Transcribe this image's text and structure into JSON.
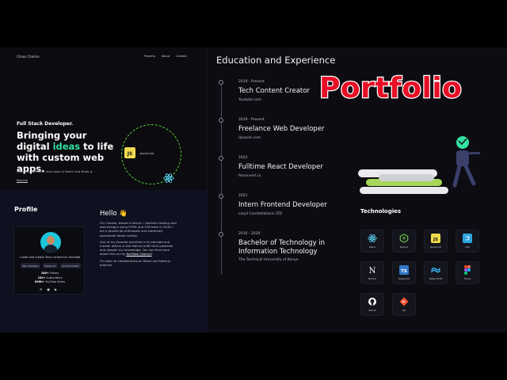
{
  "nav": {
    "brand": "Chaos Charles",
    "links": [
      "Projects",
      "About",
      "Contact"
    ]
  },
  "hero": {
    "role": "Full Stack Developer.",
    "title_before": "Bringing your digital ",
    "title_highlight": "ideas",
    "title_after": " to life with custom web apps.",
    "description": "I develop full-stack web apps in React and Node.js",
    "button": "Resume",
    "orbit_center": "JavaScript",
    "accent": "#34e0a1"
  },
  "profile": {
    "heading": "Profile",
    "tagline": "I code and create Tech content on YouTube",
    "badges": [
      "Web developer",
      "Freelancer",
      "Content Creator"
    ],
    "stats": [
      {
        "value": "180+",
        "label": "Videos"
      },
      {
        "value": "10k+",
        "label": "Subscribers"
      },
      {
        "value": "800k+",
        "label": "YouTube Views"
      }
    ],
    "hello": "Hello 👋",
    "bio_1": "I'm Charles, based in Kenya. I started creating cool web designs using HTML and CSS back in 2016. I am a JavaScript enthusiast and extremely passionate about coding.",
    "bio_2a": "One of my favorite activities is to educate and mentor others in the field to fulfill their potential and deepen my knowledge. You can find more about this on my ",
    "bio_2_link": "YouTube Channel",
    "bio_2b": ".",
    "bio_3": "I'm open to collaborating on React and Node.js projects."
  },
  "education": {
    "heading": "Education and Experience",
    "items": [
      {
        "date": "2019 - Present",
        "title": "Tech Content Creator",
        "org": "Youtube.com"
      },
      {
        "date": "2019 - Present",
        "title": "Freelance Web Developer",
        "org": "Upwork.com"
      },
      {
        "date": "2022",
        "title": "Fulltime React Developer",
        "org": "Reconvert.io"
      },
      {
        "date": "2021",
        "title": "Intern Frontend Developer",
        "org": "Lloyd Constellations LTD"
      },
      {
        "date": "2016 - 2020",
        "title": "Bachelor of Technology in Information Technology",
        "org": "The Technical University of Kenya"
      }
    ]
  },
  "overlay_title": "Portfolio",
  "technologies": {
    "heading": "Technologies",
    "items": [
      {
        "name": "React",
        "icon": "react-icon",
        "color": "#61dafb"
      },
      {
        "name": "Node.js",
        "icon": "nodejs-icon",
        "color": "#6cc24a"
      },
      {
        "name": "JavaScript",
        "icon": "javascript-icon",
        "color": "#f0db4f"
      },
      {
        "name": "CSS",
        "icon": "css-icon",
        "color": "#2aa6e0"
      },
      {
        "name": "Next.js",
        "icon": "nextjs-icon",
        "color": "#ffffff"
      },
      {
        "name": "Typescript",
        "icon": "typescript-icon",
        "color": "#3178c6"
      },
      {
        "name": "TailwindCSS",
        "icon": "tailwind-icon",
        "color": "#38bdf8"
      },
      {
        "name": "Figma",
        "icon": "figma-icon",
        "color": "#f24e1e"
      },
      {
        "name": "Github",
        "icon": "github-icon",
        "color": "#ffffff"
      },
      {
        "name": "Git",
        "icon": "git-icon",
        "color": "#f05032"
      }
    ]
  }
}
